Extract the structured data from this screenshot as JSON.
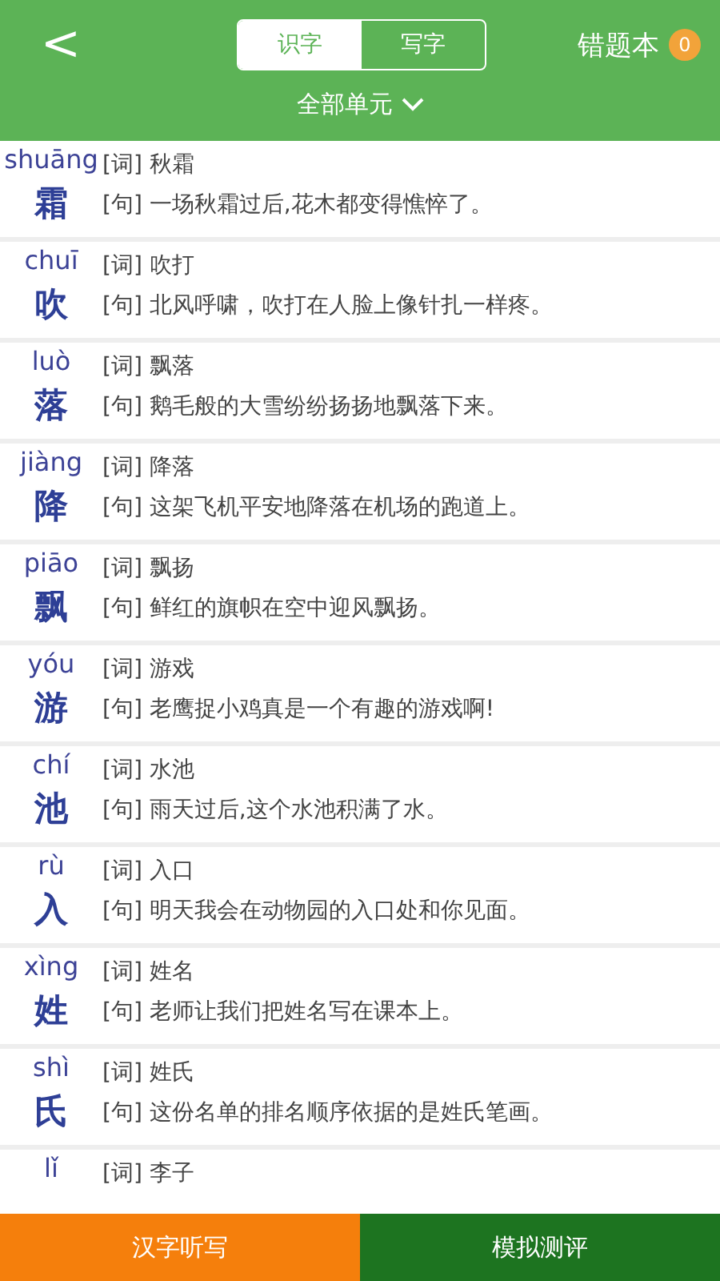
{
  "header": {
    "back": "<",
    "tabs": [
      {
        "label": "识字",
        "selected": true
      },
      {
        "label": "写字",
        "selected": false
      }
    ],
    "mistakes": {
      "label": "错题本",
      "count": "0"
    },
    "unit_filter": "全部单元"
  },
  "entries": [
    {
      "pinyin": "shuāng",
      "char": "霜",
      "word_tag": "[词]",
      "word": "秋霜",
      "sentence_tag": "[句]",
      "sentence": "一场秋霜过后,花木都变得憔悴了。"
    },
    {
      "pinyin": "chuī",
      "char": "吹",
      "word_tag": "[词]",
      "word": "吹打",
      "sentence_tag": "[句]",
      "sentence": "北风呼啸，吹打在人脸上像针扎一样疼。"
    },
    {
      "pinyin": "luò",
      "char": "落",
      "word_tag": "[词]",
      "word": "飘落",
      "sentence_tag": "[句]",
      "sentence": "鹅毛般的大雪纷纷扬扬地飘落下来。"
    },
    {
      "pinyin": "jiàng",
      "char": "降",
      "word_tag": "[词]",
      "word": "降落",
      "sentence_tag": "[句]",
      "sentence": "这架飞机平安地降落在机场的跑道上。"
    },
    {
      "pinyin": "piāo",
      "char": "飘",
      "word_tag": "[词]",
      "word": "飘扬",
      "sentence_tag": "[句]",
      "sentence": "鲜红的旗帜在空中迎风飘扬。"
    },
    {
      "pinyin": "yóu",
      "char": "游",
      "word_tag": "[词]",
      "word": "游戏",
      "sentence_tag": "[句]",
      "sentence": "老鹰捉小鸡真是一个有趣的游戏啊!"
    },
    {
      "pinyin": "chí",
      "char": "池",
      "word_tag": "[词]",
      "word": "水池",
      "sentence_tag": "[句]",
      "sentence": "雨天过后,这个水池积满了水。"
    },
    {
      "pinyin": "rù",
      "char": "入",
      "word_tag": "[词]",
      "word": "入口",
      "sentence_tag": "[句]",
      "sentence": "明天我会在动物园的入口处和你见面。"
    },
    {
      "pinyin": "xìng",
      "char": "姓",
      "word_tag": "[词]",
      "word": "姓名",
      "sentence_tag": "[句]",
      "sentence": "老师让我们把姓名写在课本上。"
    },
    {
      "pinyin": "shì",
      "char": "氏",
      "word_tag": "[词]",
      "word": "姓氏",
      "sentence_tag": "[句]",
      "sentence": "这份名单的排名顺序依据的是姓氏笔画。"
    },
    {
      "pinyin": "lǐ",
      "word_tag": "[词]",
      "word": "李子"
    }
  ],
  "bottom_bar": [
    {
      "label": "汉字听写",
      "kind": "primary"
    },
    {
      "label": "模拟测评",
      "kind": "secondary"
    }
  ]
}
